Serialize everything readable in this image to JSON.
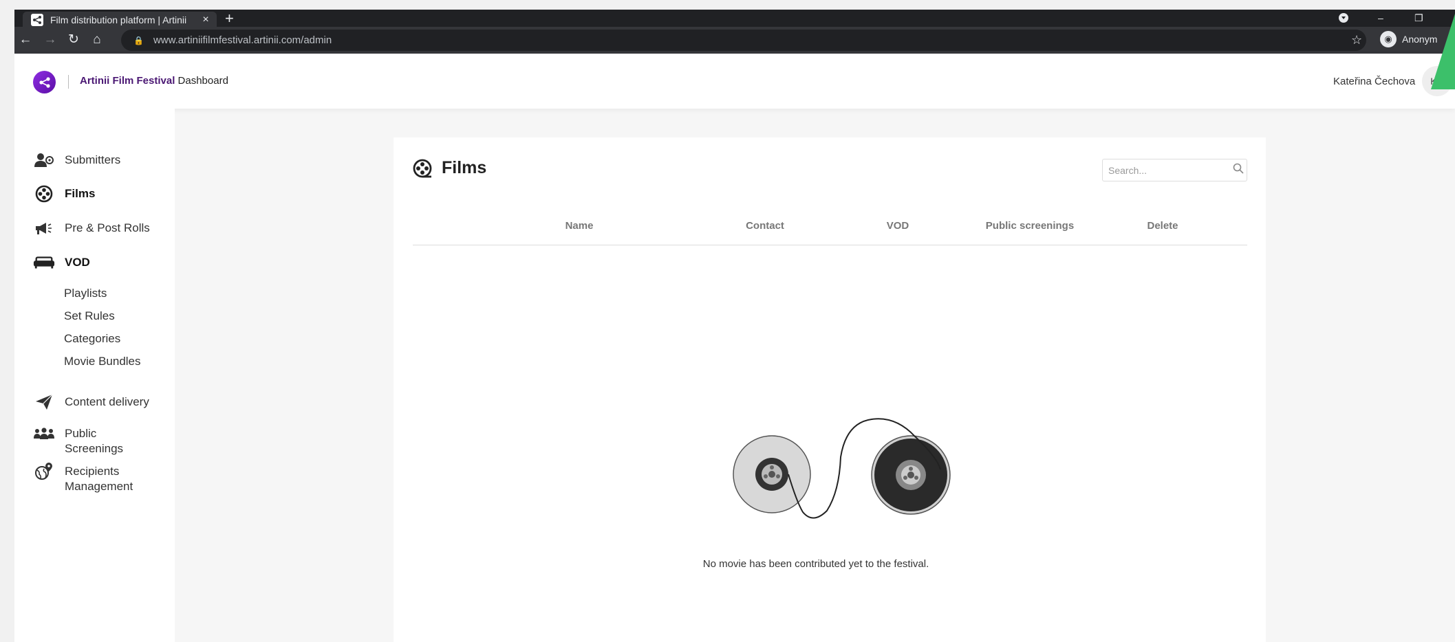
{
  "browser": {
    "tab_title": "Film distribution platform | Artinii",
    "tab_close": "×",
    "new_tab": "+",
    "url": "www.artiniifilmfestival.artinii.com/admin",
    "profile_label": "Anonym"
  },
  "header": {
    "brand_name": "Artinii Film Festival",
    "brand_suffix": " Dashboard",
    "user_name": "Kateřina Čechova",
    "avatar_initials": "KČ"
  },
  "sidebar": {
    "items": [
      {
        "label": "Submitters",
        "icon": "users-icon"
      },
      {
        "label": "Films",
        "icon": "film-reel-icon",
        "active": true
      },
      {
        "label": "Pre & Post Rolls",
        "icon": "megaphone-icon"
      },
      {
        "label": "VOD",
        "icon": "couch-icon",
        "active": true
      },
      {
        "label": "Content delivery",
        "icon": "paper-plane-icon"
      },
      {
        "label": "Public\nScreenings",
        "icon": "group-icon"
      },
      {
        "label": "Recipients\nManagement",
        "icon": "globe-pin-icon"
      }
    ],
    "vod_sub": [
      "Playlists",
      "Set Rules",
      "Categories",
      "Movie Bundles"
    ]
  },
  "main": {
    "title": "Films",
    "search_placeholder": "Search...",
    "columns": [
      "Name",
      "Contact",
      "VOD",
      "Public screenings",
      "Delete"
    ],
    "empty_message": "No movie has been contributed yet to the festival."
  },
  "colors": {
    "brand_purple": "#4a1773",
    "pointer_green": "#3cc06a"
  }
}
